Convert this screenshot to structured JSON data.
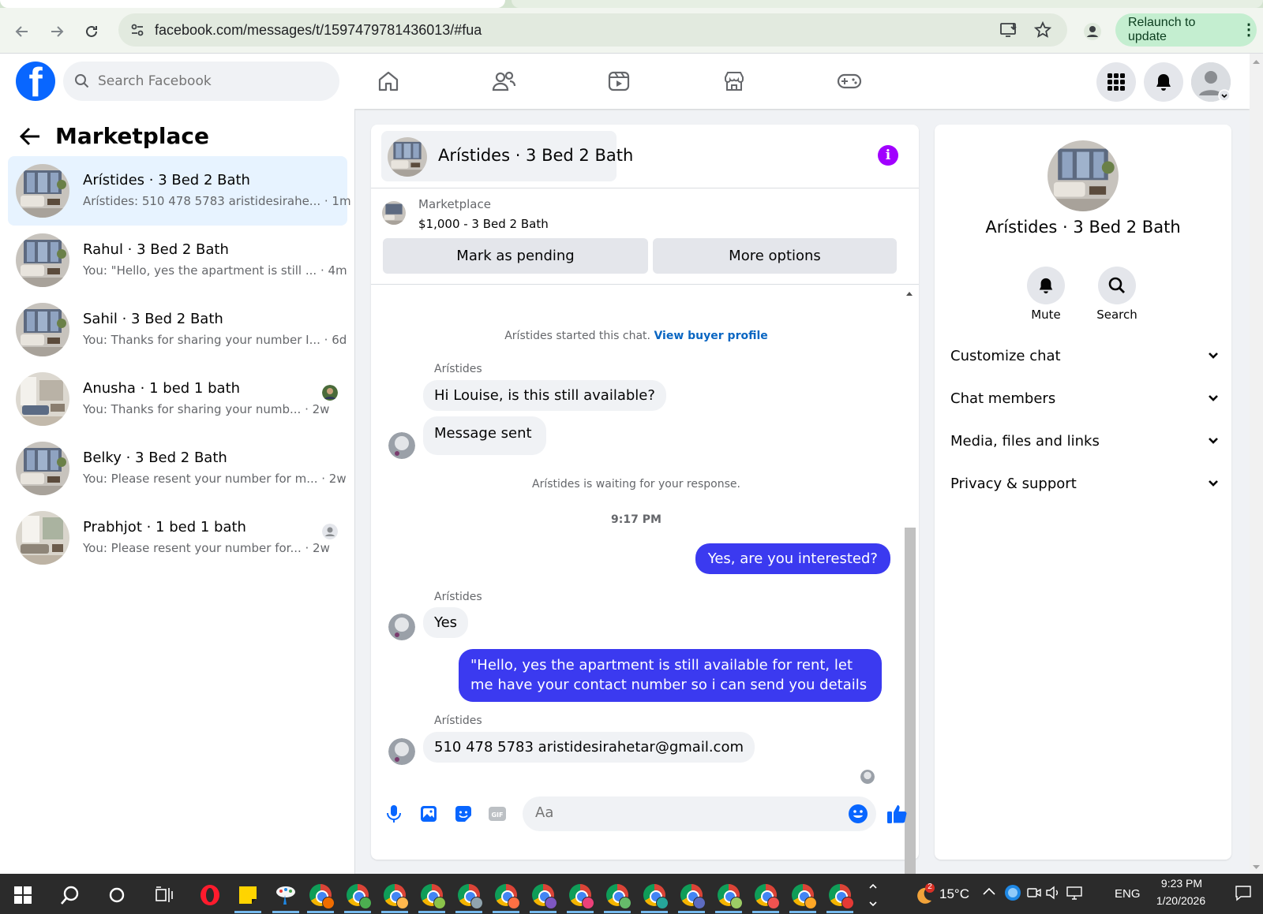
{
  "browser": {
    "url": "facebook.com/messages/t/1597479781436013/#fua",
    "relaunch_label": "Relaunch to update"
  },
  "fb_header": {
    "search_placeholder": "Search Facebook",
    "logo_letter": "f"
  },
  "sidebar": {
    "title": "Marketplace",
    "conversations": [
      {
        "name": "Arístides · 3 Bed 2 Bath",
        "snippet": "Arístides: 510 478 5783 aristidesirahe... · 1m",
        "active": true
      },
      {
        "name": "Rahul · 3 Bed 2 Bath",
        "snippet": "You: \"Hello, yes the apartment is still ... · 4m"
      },
      {
        "name": "Sahil · 3 Bed 2 Bath",
        "snippet": "You: Thanks for sharing your number I... · 6d"
      },
      {
        "name": "Anusha · 1 bed 1 bath",
        "snippet": "You: Thanks for sharing your numb... · 2w"
      },
      {
        "name": "Belky · 3 Bed 2 Bath",
        "snippet": "You: Please resent your number for m... · 2w"
      },
      {
        "name": "Prabhjot · 1 bed 1 bath",
        "snippet": "You: Please resent your number for... · 2w"
      }
    ]
  },
  "chat": {
    "title": "Arístides · 3 Bed 2 Bath",
    "info_icon": "i",
    "listing": {
      "category": "Marketplace",
      "price": "$1,000 - 3 Bed 2 Bath"
    },
    "actions": {
      "pending": "Mark as pending",
      "more": "More options"
    },
    "started_text": "Arístides started this chat.",
    "view_profile": "View buyer profile",
    "sender_name": "Arístides",
    "messages": [
      {
        "from": "them",
        "text": "Hi Louise, is this still available?"
      },
      {
        "from": "them",
        "text": "Message sent"
      },
      {
        "from": "system",
        "text": "Arístides is waiting for your response."
      },
      {
        "from": "time",
        "text": "9:17 PM"
      },
      {
        "from": "me",
        "text": "Yes, are you interested?"
      },
      {
        "from": "them",
        "text": "Yes"
      },
      {
        "from": "me",
        "text": "\"Hello, yes the apartment is still available for rent, let me have your contact number so i can send you details"
      },
      {
        "from": "them",
        "text": "510 478 5783 aristidesirahetar@gmail.com"
      }
    ],
    "composer_placeholder": "Aa"
  },
  "info_panel": {
    "name": "Arístides · 3 Bed 2 Bath",
    "mute_label": "Mute",
    "search_label": "Search",
    "sections": [
      "Customize chat",
      "Chat members",
      "Media, files and links",
      "Privacy & support"
    ]
  },
  "taskbar": {
    "weather_temp": "15°C",
    "weather_badge": "2",
    "language": "ENG",
    "time": "9:23 PM",
    "date": "1/20/2026"
  },
  "colors": {
    "fb_blue": "#0866ff",
    "outgoing_bubble": "#3b3af0",
    "active_conv": "#e7f3ff",
    "info_purple": "#a100ff"
  }
}
